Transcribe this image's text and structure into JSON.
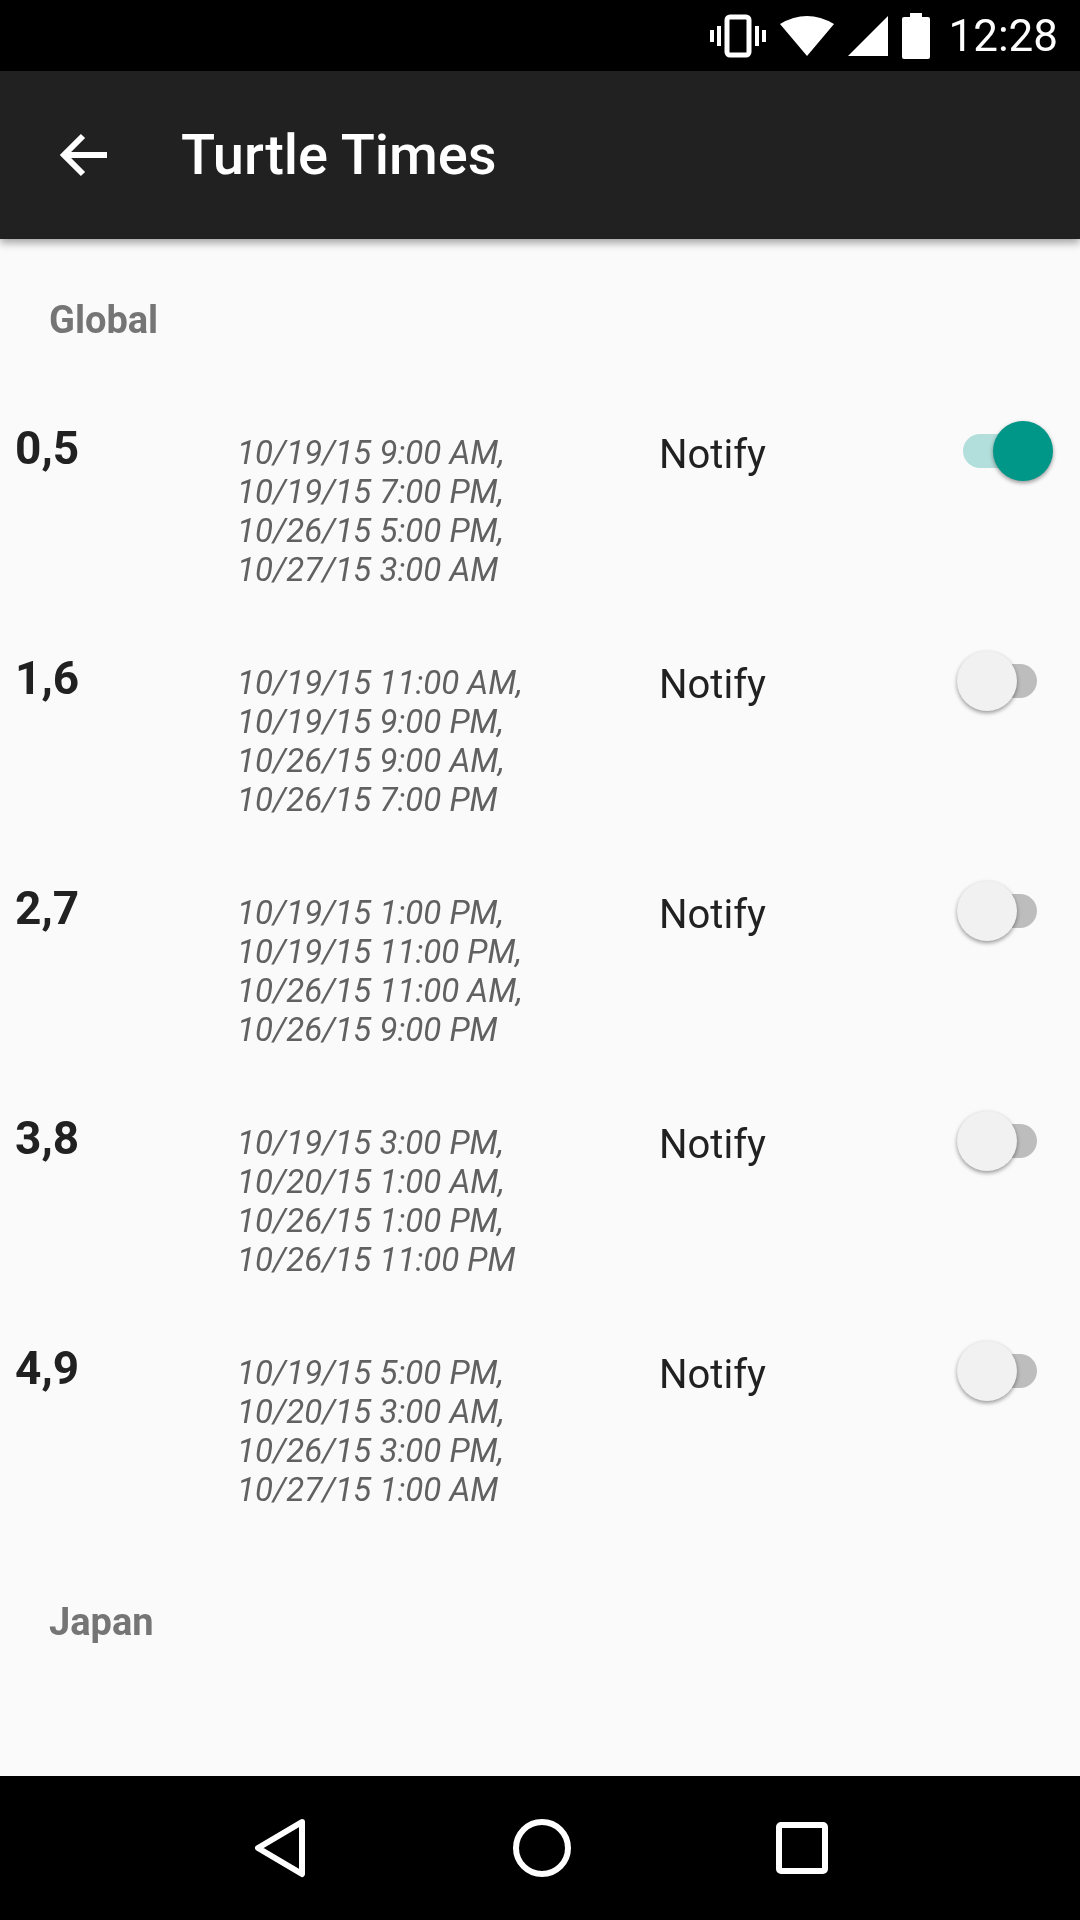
{
  "status_bar": {
    "time": "12:28"
  },
  "app_bar": {
    "title": "Turtle Times"
  },
  "sections": [
    {
      "header": "Global",
      "rows": [
        {
          "label": "0,5",
          "times": "10/19/15 9:00 AM,\n10/19/15 7:00 PM,\n10/26/15 5:00 PM,\n10/27/15 3:00 AM",
          "notify_label": "Notify",
          "on": true
        },
        {
          "label": "1,6",
          "times": "10/19/15 11:00 AM,\n10/19/15 9:00 PM,\n10/26/15 9:00 AM,\n10/26/15 7:00 PM",
          "notify_label": "Notify",
          "on": false
        },
        {
          "label": "2,7",
          "times": "10/19/15 1:00 PM,\n10/19/15 11:00 PM,\n10/26/15 11:00 AM,\n10/26/15 9:00 PM",
          "notify_label": "Notify",
          "on": false
        },
        {
          "label": "3,8",
          "times": "10/19/15 3:00 PM,\n10/20/15 1:00 AM,\n10/26/15 1:00 PM,\n10/26/15 11:00 PM",
          "notify_label": "Notify",
          "on": false
        },
        {
          "label": "4,9",
          "times": "10/19/15 5:00 PM,\n10/20/15 3:00 AM,\n10/26/15 3:00 PM,\n10/27/15 1:00 AM",
          "notify_label": "Notify",
          "on": false
        }
      ]
    },
    {
      "header": "Japan"
    }
  ]
}
